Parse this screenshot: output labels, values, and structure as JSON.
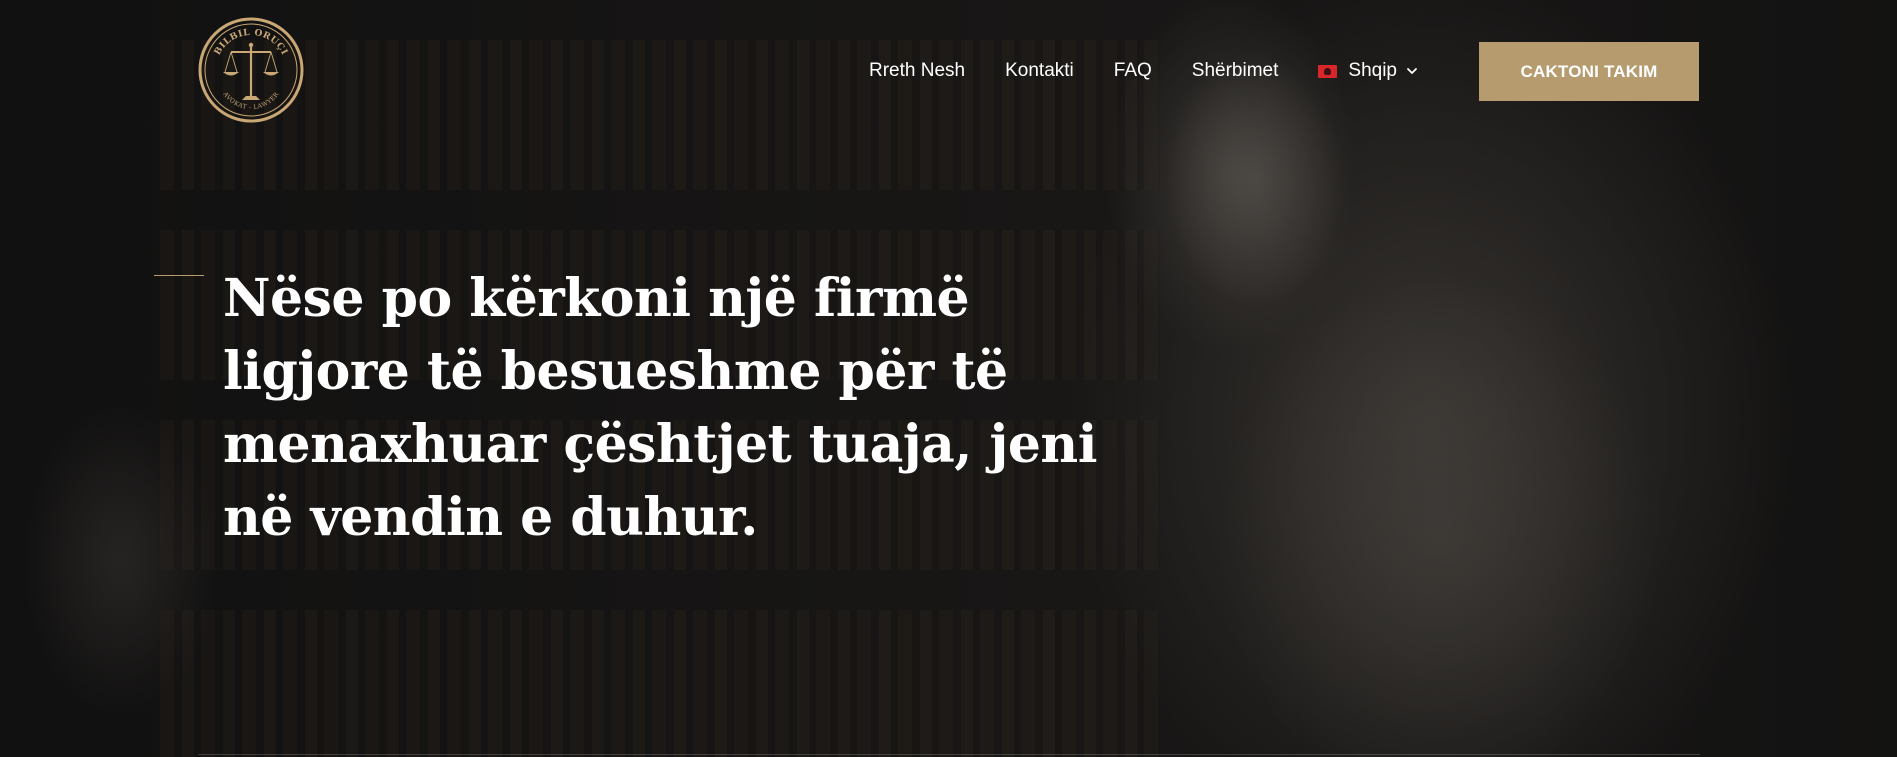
{
  "header": {
    "logo": {
      "icon": "scales-of-justice-icon",
      "top_text": "BILBIL ORUÇI",
      "bottom_text": "AVOKAT - LAWYER"
    },
    "nav": [
      {
        "label": "Rreth Nesh"
      },
      {
        "label": "Kontakti"
      },
      {
        "label": "FAQ"
      },
      {
        "label": "Shërbimet"
      }
    ],
    "language": {
      "label": "Shqip",
      "flag_icon": "albanian-flag-icon",
      "chevron_icon": "chevron-down-icon"
    },
    "cta_label": "CAKTONI TAKIM"
  },
  "hero": {
    "headline": "Nëse po kërkoni një firmë ligjore të besueshme për të menaxhuar çështjet tuaja, jeni në vendin e duhur."
  },
  "colors": {
    "accent": "#b69b6e",
    "background": "#171616",
    "text": "#ffffff"
  }
}
